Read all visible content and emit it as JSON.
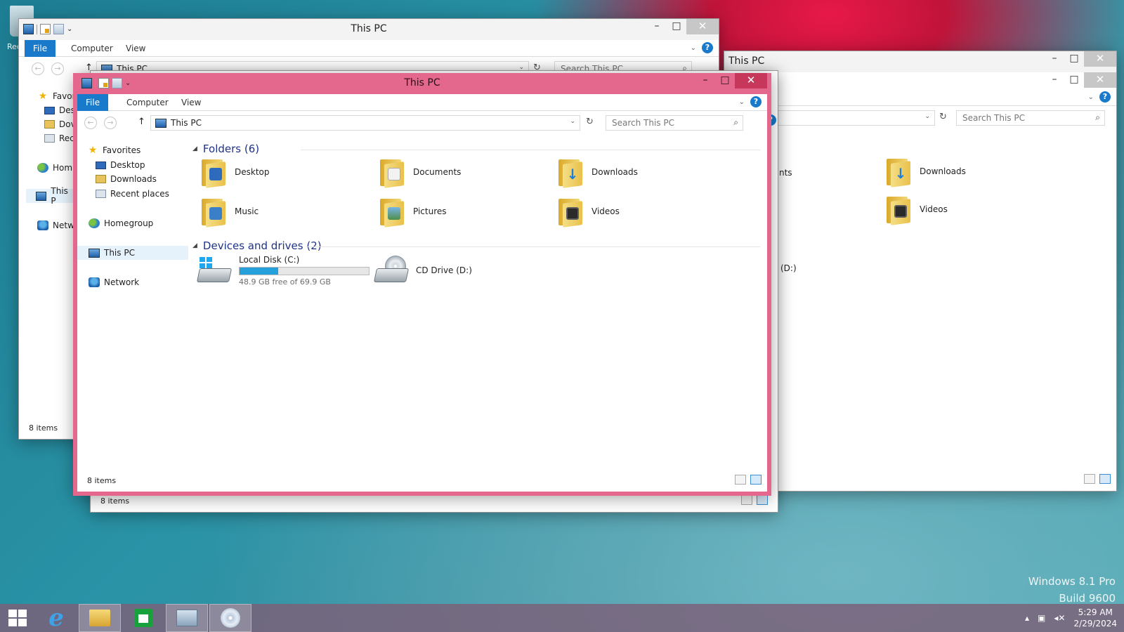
{
  "desktop": {
    "recycle_label": "Rec"
  },
  "window_back_right": {
    "title": "This PC",
    "search_placeholder": "Search This PC",
    "partial_label_1": "nts",
    "partial_label_2": "(D:)",
    "tiles": [
      "Downloads",
      "Videos"
    ]
  },
  "window_back_left": {
    "title": "This PC",
    "tabs": {
      "file": "File",
      "computer": "Computer",
      "view": "View"
    },
    "address": "This PC",
    "search_placeholder": "Search This PC",
    "nav": [
      "Favor",
      "Des",
      "Dov",
      "Rec",
      "Hom",
      "This P",
      "Netw"
    ],
    "status": "8 items"
  },
  "window_mid": {
    "status": "8 items"
  },
  "window_active": {
    "title": "This PC",
    "tabs": {
      "file": "File",
      "computer": "Computer",
      "view": "View"
    },
    "address": "This PC",
    "search_placeholder": "Search This PC",
    "nav": {
      "favorites": "Favorites",
      "desktop": "Desktop",
      "downloads": "Downloads",
      "recent": "Recent places",
      "homegroup": "Homegroup",
      "this_pc": "This PC",
      "network": "Network"
    },
    "folders_header": "Folders (6)",
    "folders": [
      "Desktop",
      "Documents",
      "Downloads",
      "Music",
      "Pictures",
      "Videos"
    ],
    "devices_header": "Devices and drives (2)",
    "drive_c": {
      "name": "Local Disk (C:)",
      "free": "48.9 GB free of 69.9 GB",
      "used_fraction": 0.3
    },
    "drive_d": {
      "name": "CD Drive (D:)"
    },
    "status": "8 items"
  },
  "watermark": {
    "line1": "Windows 8.1 Pro",
    "line2": "Build 9600"
  },
  "clock": {
    "time": "5:29 AM",
    "date": "2/29/2024"
  },
  "icons": {
    "minimize": "–",
    "maximize": "□",
    "close": "✕",
    "help": "?",
    "back": "←",
    "forward": "→",
    "up": "↑",
    "refresh": "↻",
    "search": "⌕",
    "chevron": "⌄"
  }
}
